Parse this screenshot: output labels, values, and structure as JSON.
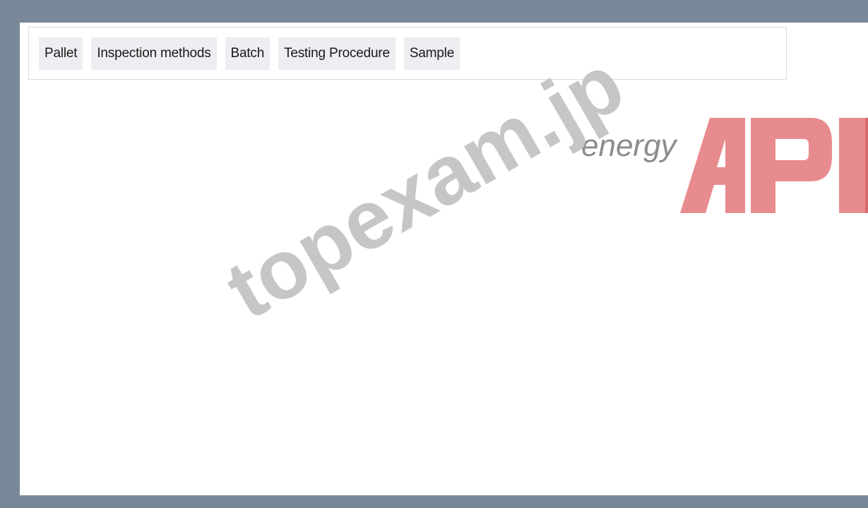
{
  "tabs": [
    {
      "label": "Pallet"
    },
    {
      "label": "Inspection methods"
    },
    {
      "label": "Batch"
    },
    {
      "label": "Testing Procedure"
    },
    {
      "label": "Sample"
    }
  ],
  "watermark": {
    "text": "topexam.jp"
  },
  "logo": {
    "word": "energy",
    "mark": "API",
    "color": "#e88b8f"
  }
}
